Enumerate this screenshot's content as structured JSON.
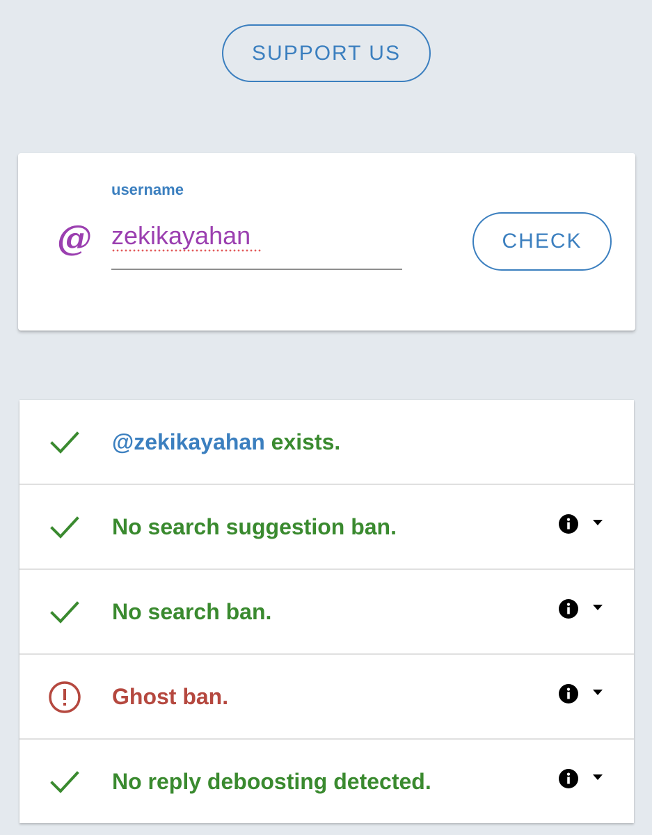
{
  "header": {
    "support_label": "SUPPORT US"
  },
  "form": {
    "label": "username",
    "value": "zekikayahan",
    "prefix_icon": "at-sign-icon",
    "check_label": "CHECK"
  },
  "results": [
    {
      "status": "ok",
      "icon": "check-icon",
      "handle": "@zekikayahan",
      "text": " exists.",
      "has_info": false
    },
    {
      "status": "ok",
      "icon": "check-icon",
      "text": "No search suggestion ban.",
      "has_info": true
    },
    {
      "status": "ok",
      "icon": "check-icon",
      "text": "No search ban.",
      "has_info": true
    },
    {
      "status": "warning",
      "icon": "alert-circle-icon",
      "text": "Ghost ban.",
      "has_info": true
    },
    {
      "status": "ok",
      "icon": "check-icon",
      "text": "No reply deboosting detected.",
      "has_info": true
    }
  ],
  "colors": {
    "background": "#e4e9ee",
    "accent_blue": "#3b7fbf",
    "ok_green": "#3a8a2f",
    "warn_red": "#b5483f",
    "input_purple": "#9b3fb0"
  },
  "at_symbol": "@"
}
